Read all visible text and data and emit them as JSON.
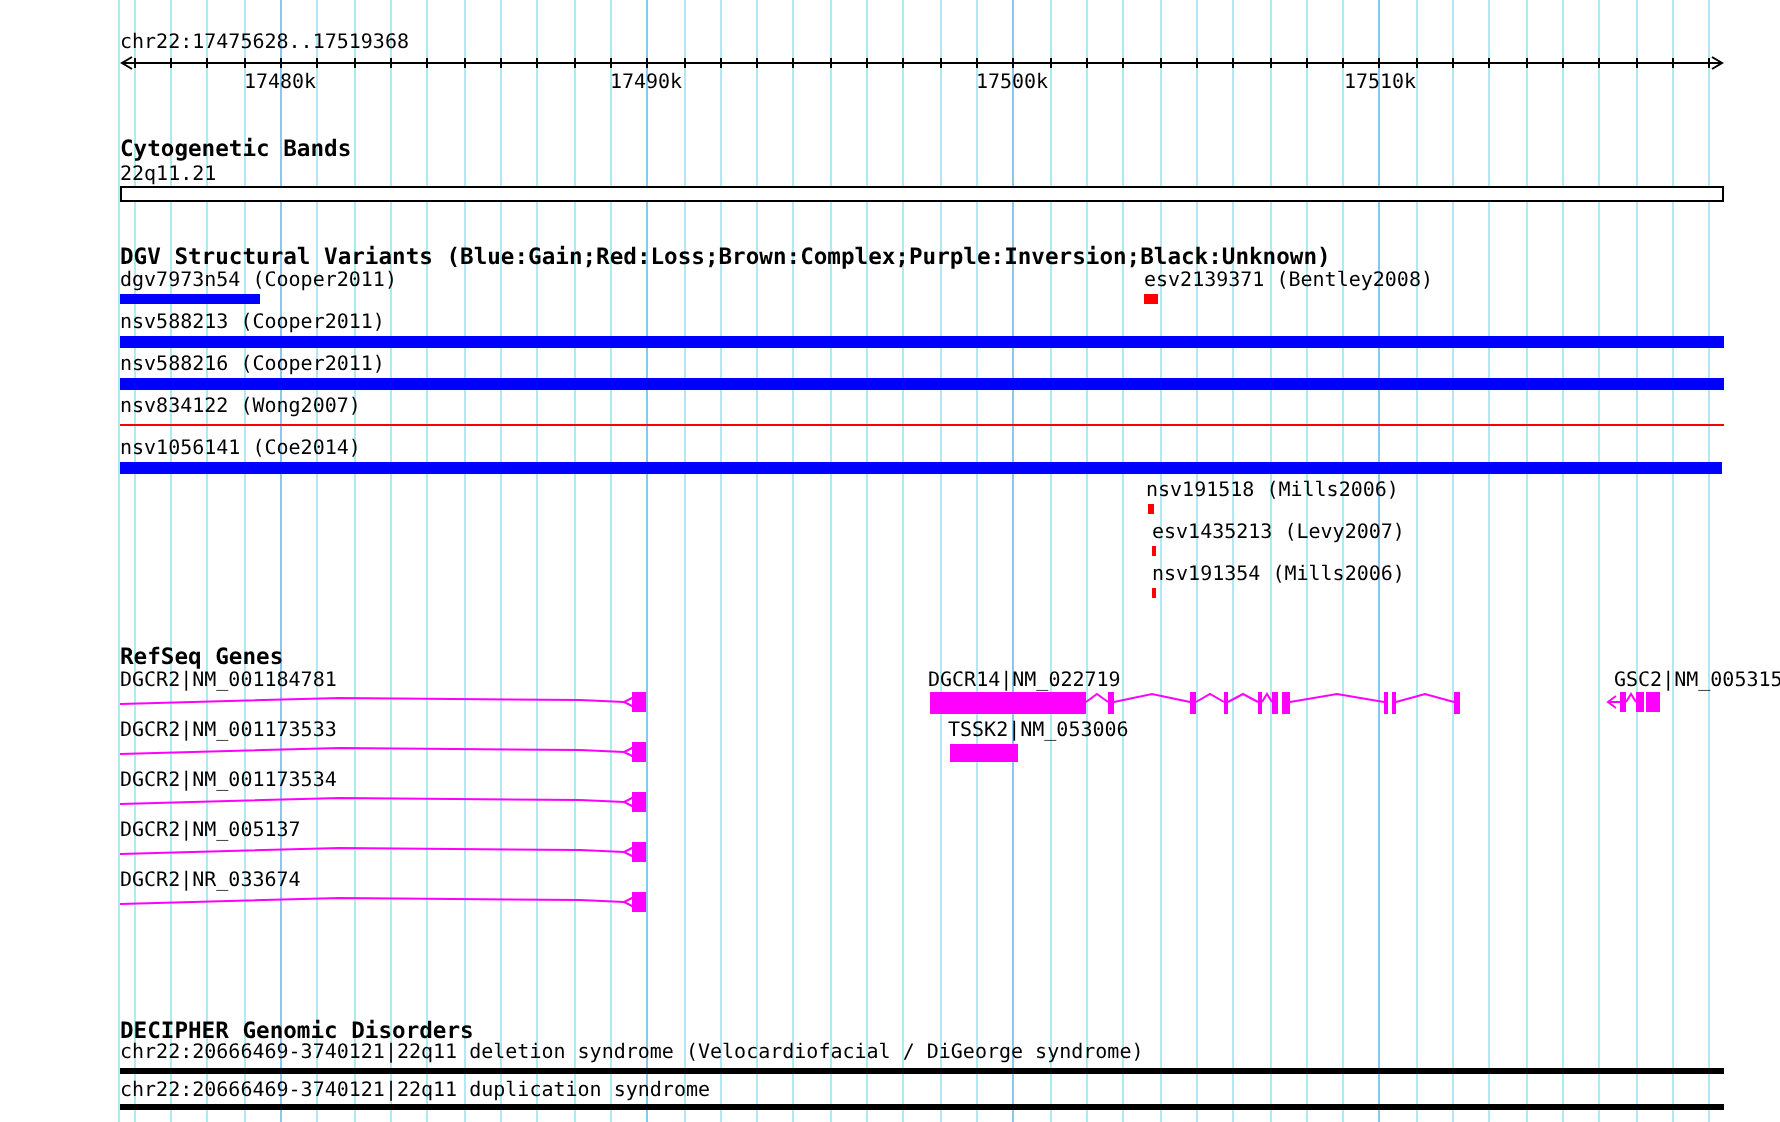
{
  "ruler": {
    "location": "chr22:17475628..17519368",
    "ticks": [
      "17480k",
      "17490k",
      "17500k",
      "17510k"
    ]
  },
  "cytogenetic_bands": {
    "title": "Cytogenetic Bands",
    "bands": [
      {
        "label": "22q11.21"
      }
    ]
  },
  "dgv_variants": {
    "title": "DGV Structural Variants (Blue:Gain;Red:Loss;Brown:Complex;Purple:Inversion;Black:Unknown)",
    "variants": [
      {
        "label": "dgv7973n54 (Cooper2011)",
        "color": "#0000ff"
      },
      {
        "label": "esv2139371 (Bentley2008)",
        "color": "#ff0000"
      },
      {
        "label": "nsv588213 (Cooper2011)",
        "color": "#0000ff"
      },
      {
        "label": "nsv588216 (Cooper2011)",
        "color": "#0000ff"
      },
      {
        "label": "nsv834122 (Wong2007)",
        "color": "#ff0000"
      },
      {
        "label": "nsv1056141 (Coe2014)",
        "color": "#0000ff"
      },
      {
        "label": "nsv191518 (Mills2006)",
        "color": "#ff0000"
      },
      {
        "label": "esv1435213 (Levy2007)",
        "color": "#ff0000"
      },
      {
        "label": "nsv191354 (Mills2006)",
        "color": "#ff0000"
      }
    ]
  },
  "refseq_genes": {
    "title": "RefSeq Genes",
    "genes": [
      {
        "label": "DGCR2|NM_001184781"
      },
      {
        "label": "DGCR2|NM_001173533"
      },
      {
        "label": "DGCR2|NM_001173534"
      },
      {
        "label": "DGCR2|NM_005137"
      },
      {
        "label": "DGCR2|NR_033674"
      },
      {
        "label": "DGCR14|NM_022719"
      },
      {
        "label": "TSSK2|NM_053006"
      },
      {
        "label": "GSC2|NM_005315"
      }
    ]
  },
  "decipher": {
    "title": "DECIPHER Genomic Disorders",
    "disorders": [
      {
        "label": "chr22:20666469-3740121|22q11 deletion syndrome (Velocardiofacial / DiGeorge syndrome)"
      },
      {
        "label": "chr22:20666469-3740121|22q11 duplication syndrome"
      }
    ]
  }
}
